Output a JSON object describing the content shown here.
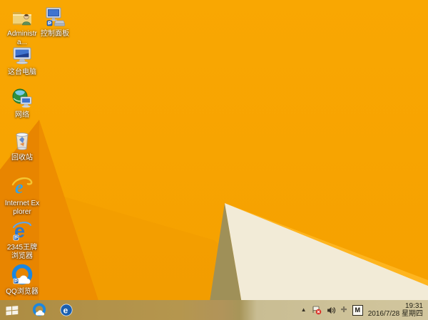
{
  "wallpaper": {
    "base_top": "#f9a702",
    "base": "#f5a000",
    "shade_band": "#ef9a00",
    "wedge": "#ee8e00",
    "wedge_dark": "#e47e00",
    "shadow": "#9f9058",
    "highlight": "#ffb722",
    "cream": "#f2ebd7"
  },
  "desktop": {
    "icons": [
      {
        "name": "administrator-folder",
        "label": "Administra..."
      },
      {
        "name": "control-panel",
        "label": "控制面板"
      },
      {
        "name": "this-pc",
        "label": "这台电脑"
      },
      {
        "name": "network",
        "label": "网络"
      },
      {
        "name": "recycle-bin",
        "label": "回收站"
      },
      {
        "name": "internet-explorer",
        "label": "Internet Explorer"
      },
      {
        "name": "2345-browser",
        "label": "2345王牌浏览器"
      },
      {
        "name": "qq-browser",
        "label": "QQ浏览器"
      }
    ]
  },
  "taskbar": {
    "start": {
      "icon": "windows-start-icon"
    },
    "pinned": [
      {
        "icon": "qq-browser-icon"
      },
      {
        "icon": "2345-browser-icon"
      }
    ],
    "tray": {
      "chevron_glyph": "▲",
      "plus_glyph": "✚",
      "ime_letter": "M",
      "icons": [
        "show-hidden-icons",
        "action-center-alert",
        "volume",
        "input-indicator",
        "ime-mode"
      ],
      "clock": {
        "time": "19:31",
        "date": "2016/7/28 星期四"
      }
    }
  }
}
